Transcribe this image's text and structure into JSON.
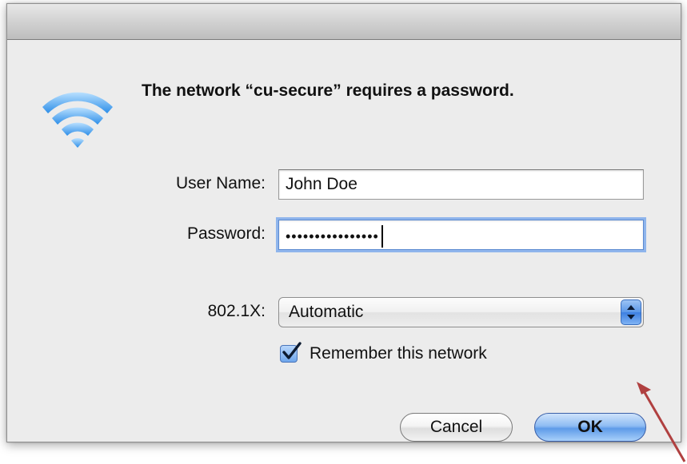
{
  "dialog": {
    "message": "The network “cu-secure” requires a password."
  },
  "form": {
    "username_label": "User Name:",
    "username_value": "John Doe",
    "password_label": "Password:",
    "password_masked": "••••••••••••••••",
    "auth_label": "802.1X:",
    "auth_selected": "Automatic",
    "remember_label": "Remember this network",
    "remember_checked": true
  },
  "buttons": {
    "cancel_label": "Cancel",
    "ok_label": "OK"
  },
  "icons": {
    "wifi": "wifi-icon",
    "checkmark": "checkmark-icon",
    "select_arrows": "up-down-arrows-icon",
    "annotation": "annotation-arrow"
  },
  "colors": {
    "wifi_blue": "#3d9bf0",
    "annotation_red": "#b04040",
    "focus_ring": "#8fb5ec"
  }
}
